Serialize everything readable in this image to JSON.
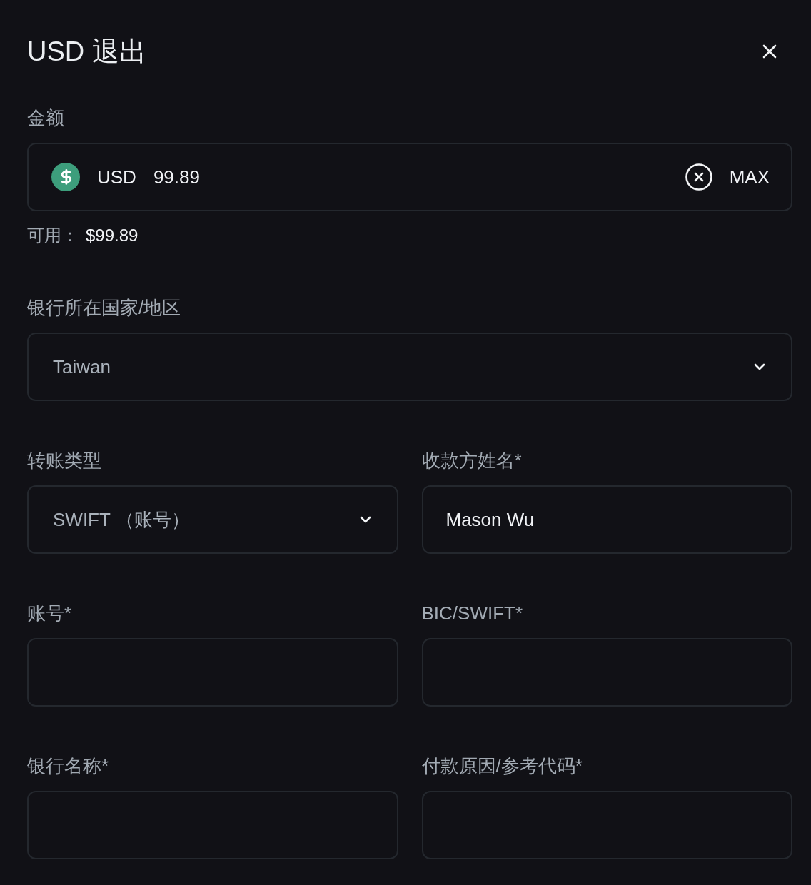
{
  "dialog": {
    "title": "USD 退出"
  },
  "amount": {
    "label": "金额",
    "currency": "USD",
    "value": "99.89",
    "max_button": "MAX"
  },
  "available": {
    "label": "可用：",
    "value": "$99.89"
  },
  "rows": [
    [
      {
        "kind": "select",
        "label": "银行所在国家/地区",
        "value": "Taiwan"
      }
    ],
    [
      {
        "kind": "select",
        "label": "转账类型",
        "value": "SWIFT （账号）"
      },
      {
        "kind": "text",
        "label": "收款方姓名*",
        "value": "Mason Wu"
      }
    ],
    [
      {
        "kind": "text",
        "label": "账号*"
      },
      {
        "kind": "text",
        "label": "BIC/SWIFT*"
      }
    ],
    [
      {
        "kind": "text",
        "label": "银行名称*"
      },
      {
        "kind": "text",
        "label": "付款原因/参考代码*"
      }
    ]
  ]
}
